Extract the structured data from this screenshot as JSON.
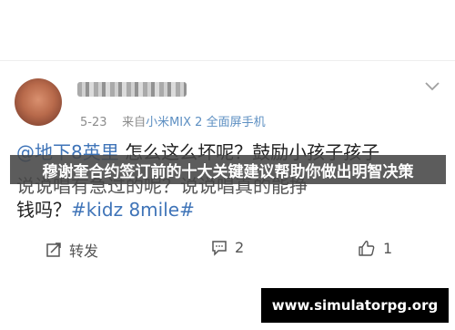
{
  "post": {
    "meta_time": "5-23",
    "meta_from": "来自",
    "meta_device": "小米MIX 2 全面屏手机",
    "line1_mention": "@地下8英里",
    "line1_text": " 怎么这么坏呢？鼓励小孩子孩子",
    "line2_text": "说说唱有急过的呢？说说唱真的能挣",
    "line3_text": "钱吗？",
    "line3_tags": "#kidz 8mile#"
  },
  "overlay": {
    "headline": "穆谢奎合约签订前的十大关键建议帮助你做出明智决策"
  },
  "actions": {
    "repost_label": "转发",
    "comment_count": "2",
    "like_count": "1"
  },
  "watermark": {
    "text": "www.simulatorpg.org"
  },
  "icons": {
    "chevron": "chevron-down-icon",
    "repost": "repost-icon",
    "comment": "comment-icon",
    "like": "thumbs-up-icon"
  },
  "colors": {
    "link_blue": "#3f74b8",
    "device_blue": "#5d8fc2",
    "overlay_bg": "#464646",
    "watermark_bg": "#000000"
  }
}
